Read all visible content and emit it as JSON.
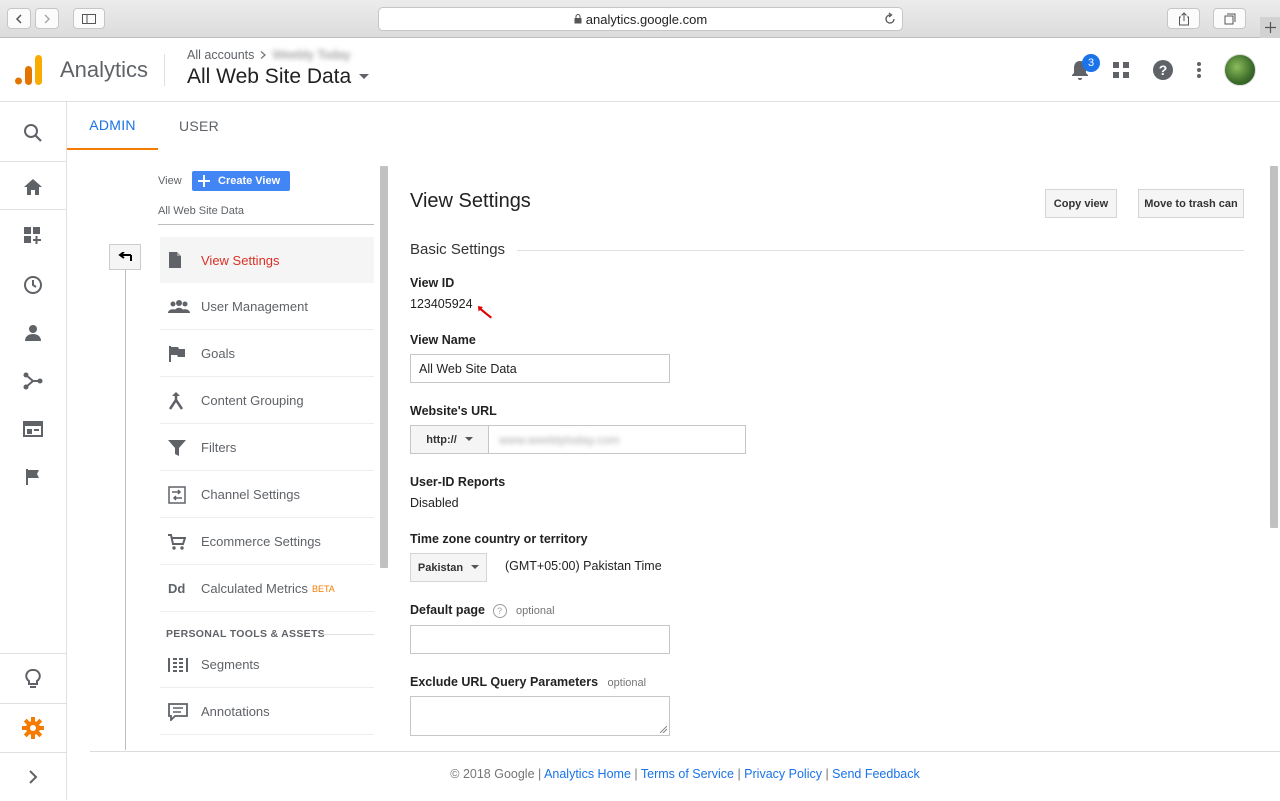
{
  "browser": {
    "url": "analytics.google.com"
  },
  "header": {
    "app_name": "Analytics",
    "breadcrumb_root": "All accounts",
    "breadcrumb_property": "Weebly Today",
    "view_name": "All Web Site Data",
    "notification_count": "3"
  },
  "tabs": [
    {
      "label": "ADMIN"
    },
    {
      "label": "USER"
    }
  ],
  "menu": {
    "view_label": "View",
    "create_view_label": "Create View",
    "current_view": "All Web Site Data",
    "items": [
      {
        "label": "View Settings",
        "icon": "document-icon"
      },
      {
        "label": "User Management",
        "icon": "people-icon"
      },
      {
        "label": "Goals",
        "icon": "flag-icon"
      },
      {
        "label": "Content Grouping",
        "icon": "content-grouping-icon"
      },
      {
        "label": "Filters",
        "icon": "filter-icon"
      },
      {
        "label": "Channel Settings",
        "icon": "channel-settings-icon"
      },
      {
        "label": "Ecommerce Settings",
        "icon": "cart-icon"
      },
      {
        "label": "Calculated Metrics",
        "icon": "dd-icon",
        "badge": "BETA"
      }
    ],
    "section_header": "PERSONAL TOOLS & ASSETS",
    "tools": [
      {
        "label": "Segments",
        "icon": "segments-icon"
      },
      {
        "label": "Annotations",
        "icon": "annotation-icon"
      }
    ]
  },
  "settings": {
    "title": "View Settings",
    "copy_view_label": "Copy view",
    "trash_label": "Move to trash can",
    "section_title": "Basic Settings",
    "view_id_label": "View ID",
    "view_id_value": "123405924",
    "view_name_label": "View Name",
    "view_name_value": "All Web Site Data",
    "website_url_label": "Website's URL",
    "protocol": "http://",
    "website_url_value": "www.weeblytoday.com",
    "user_id_label": "User-ID Reports",
    "user_id_value": "Disabled",
    "timezone_label": "Time zone country or territory",
    "timezone_country": "Pakistan",
    "timezone_value": "(GMT+05:00) Pakistan Time",
    "default_page_label": "Default page",
    "optional": "optional",
    "default_page_value": "",
    "exclude_label": "Exclude URL Query Parameters",
    "exclude_value": ""
  },
  "footer": {
    "copyright": "© 2018 Google",
    "links": [
      "Analytics Home",
      "Terms of Service",
      "Privacy Policy",
      "Send Feedback"
    ]
  },
  "colors": {
    "accent": "#1a73e8",
    "active_tab_underline": "#f57c00",
    "active_menu": "#d93025",
    "create_view_button": "#4285f4"
  }
}
